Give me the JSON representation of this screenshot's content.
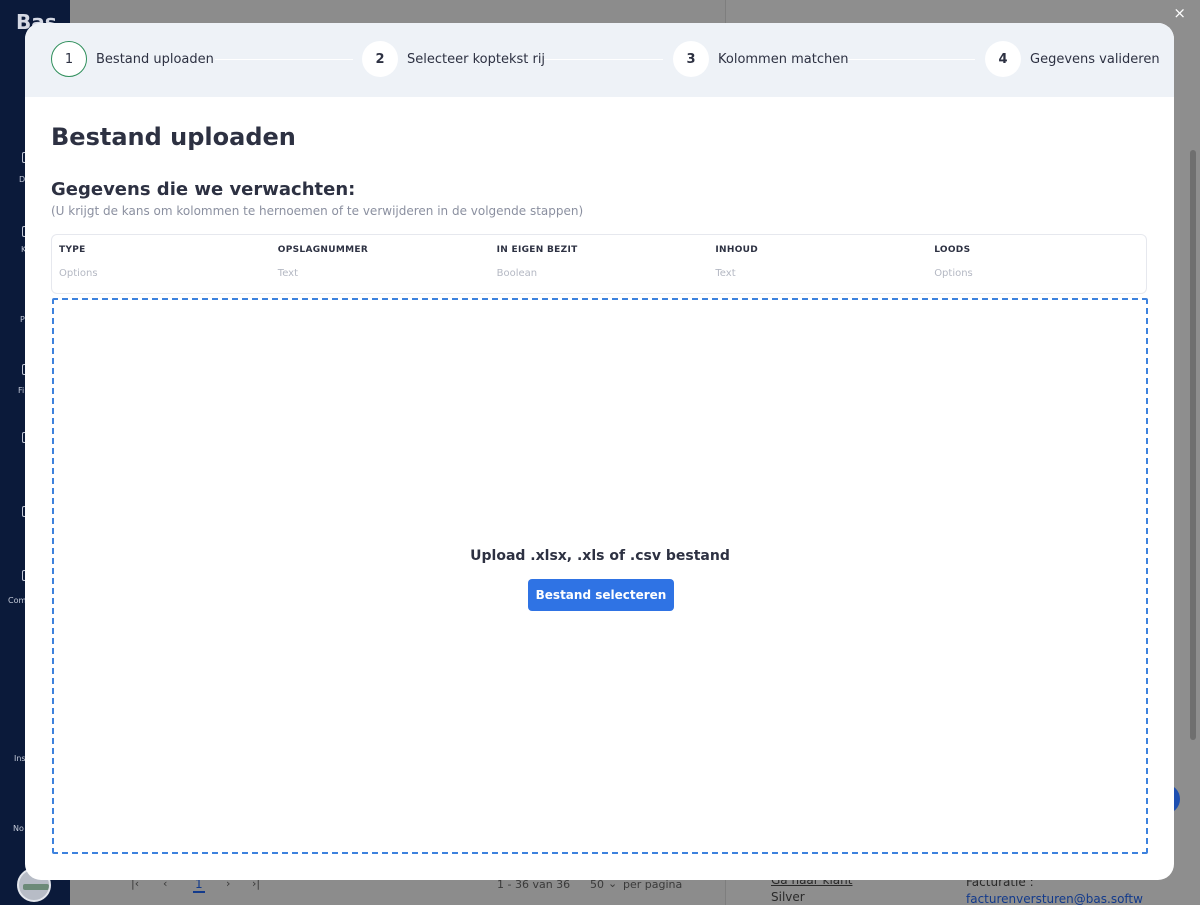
{
  "background": {
    "brand": "Bas",
    "sidebar_labels": [
      "D",
      "K",
      "P",
      "Fi",
      "Com",
      "Ins",
      "No"
    ],
    "pagination": {
      "first": "|‹",
      "prev": "‹",
      "current_page": "1",
      "next": "›",
      "last": "›|",
      "range": "1 - 36 van 36",
      "per_page": "50",
      "per_page_label": "per pagina"
    },
    "right_panel": {
      "goto_client": "Ga naar klant",
      "tier": "Silver",
      "billing_label": "Facturatie :",
      "billing_email": "facturenversturen@bas.softw"
    }
  },
  "close_label": "×",
  "steps": [
    {
      "number": "1",
      "label": "Bestand uploaden",
      "active": true
    },
    {
      "number": "2",
      "label": "Selecteer koptekst rij",
      "active": false
    },
    {
      "number": "3",
      "label": "Kolommen matchen",
      "active": false
    },
    {
      "number": "4",
      "label": "Gegevens valideren",
      "active": false
    }
  ],
  "page_title": "Bestand uploaden",
  "expected": {
    "title": "Gegevens die we verwachten:",
    "subtitle": "(U krijgt de kans om kolommen te hernoemen of te verwijderen in de volgende stappen)",
    "columns": [
      {
        "name": "TYPE",
        "type": "Options"
      },
      {
        "name": "OPSLAGNUMMER",
        "type": "Text"
      },
      {
        "name": "IN EIGEN BEZIT",
        "type": "Boolean"
      },
      {
        "name": "INHOUD",
        "type": "Text"
      },
      {
        "name": "LOODS",
        "type": "Options"
      }
    ]
  },
  "upload": {
    "text": "Upload .xlsx, .xls of .csv bestand",
    "button": "Bestand selecteren"
  },
  "colors": {
    "accent": "#2f73e4",
    "dropzone_border": "#3d82de",
    "active_step_border": "#2f8f5b",
    "stepper_bg": "#eef2f7"
  }
}
